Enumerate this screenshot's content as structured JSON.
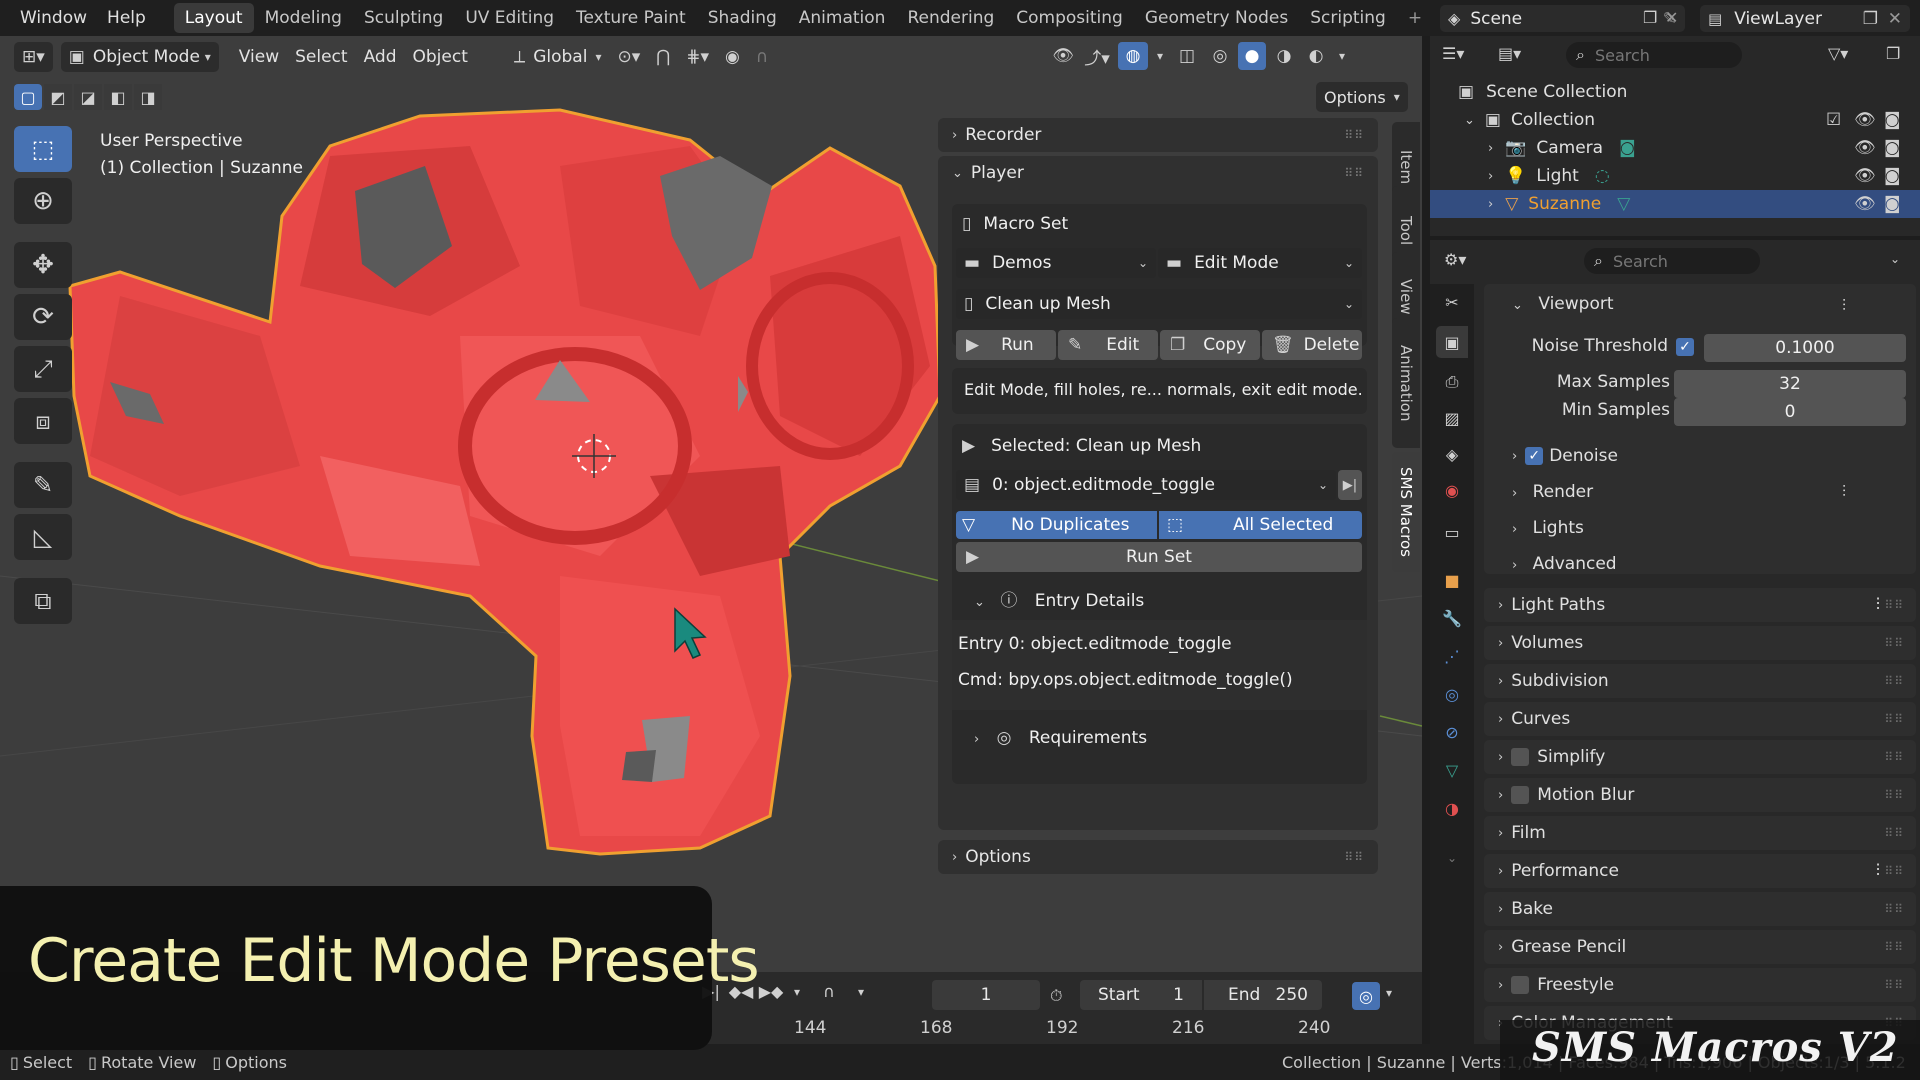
{
  "topbar": {
    "menus": [
      "Window",
      "Help"
    ],
    "workspaces": [
      "Layout",
      "Modeling",
      "Sculpting",
      "UV Editing",
      "Texture Paint",
      "Shading",
      "Animation",
      "Rendering",
      "Compositing",
      "Geometry Nodes",
      "Scripting"
    ],
    "active_workspace": "Layout",
    "scene": "Scene",
    "view_layer": "ViewLayer"
  },
  "viewport_header": {
    "mode": "Object Mode",
    "menus": [
      "View",
      "Select",
      "Add",
      "Object"
    ],
    "transform_orientation": "Global",
    "options_label": "Options"
  },
  "viewport_info": {
    "line1": "User Perspective",
    "line2": "(1) Collection | Suzanne"
  },
  "npanel": {
    "recorder_label": "Recorder",
    "player_label": "Player",
    "macro_set_label": "Macro Set",
    "category": "Demos",
    "mode_filter": "Edit Mode",
    "macro_name": "Clean up Mesh",
    "run_label": "Run",
    "edit_label": "Edit",
    "copy_label": "Copy",
    "delete_label": "Delete",
    "description": "Edit Mode, fill holes, re... normals, exit edit mode.",
    "selected_label": "Selected: Clean up Mesh",
    "entry": "0: object.editmode_toggle",
    "no_duplicates_label": "No Duplicates",
    "all_selected_label": "All Selected",
    "run_set_label": "Run Set",
    "entry_details_label": "Entry Details",
    "entry_line": "Entry 0: object.editmode_toggle",
    "cmd_line": "Cmd: bpy.ops.object.editmode_toggle()",
    "requirements_label": "Requirements",
    "options_label": "Options"
  },
  "sidebar_tabs": [
    "Item",
    "Tool",
    "View",
    "Animation",
    "SMS Macros"
  ],
  "timeline": {
    "current_frame": "1",
    "start_label": "Start",
    "start_value": "1",
    "end_label": "End",
    "end_value": "250",
    "ticks": [
      "144",
      "168",
      "192",
      "216",
      "240"
    ]
  },
  "outliner": {
    "search_placeholder": "Search",
    "scene_collection": "Scene Collection",
    "items": [
      {
        "name": "Collection"
      },
      {
        "name": "Camera"
      },
      {
        "name": "Light"
      },
      {
        "name": "Suzanne"
      }
    ]
  },
  "properties": {
    "search_placeholder": "Search",
    "viewport_label": "Viewport",
    "noise_threshold_label": "Noise Threshold",
    "noise_threshold_value": "0.1000",
    "max_samples_label": "Max Samples",
    "max_samples_value": "32",
    "min_samples_label": "Min Samples",
    "min_samples_value": "0",
    "denoise_label": "Denoise",
    "render_label": "Render",
    "lights_label": "Lights",
    "advanced_label": "Advanced",
    "sections": [
      "Light Paths",
      "Volumes",
      "Subdivision",
      "Curves",
      "Simplify",
      "Motion Blur",
      "Film",
      "Performance",
      "Bake",
      "Grease Pencil",
      "Freestyle",
      "Color Management"
    ]
  },
  "statusbar": {
    "select": "Select",
    "rotate": "Rotate View",
    "options": "Options",
    "stats": "Collection | Suzanne | Verts:1,014 | Faces:984 | Tris:1,906 | Objects:1/3 | 5.1.2"
  },
  "overlay": {
    "caption": "Create Edit Mode Presets",
    "watermark": "SMS Macros V2"
  },
  "colors": {
    "accent": "#4772b3",
    "mesh": "#e84848",
    "outline": "#f0a030",
    "caption_text": "#f4f0b0"
  }
}
